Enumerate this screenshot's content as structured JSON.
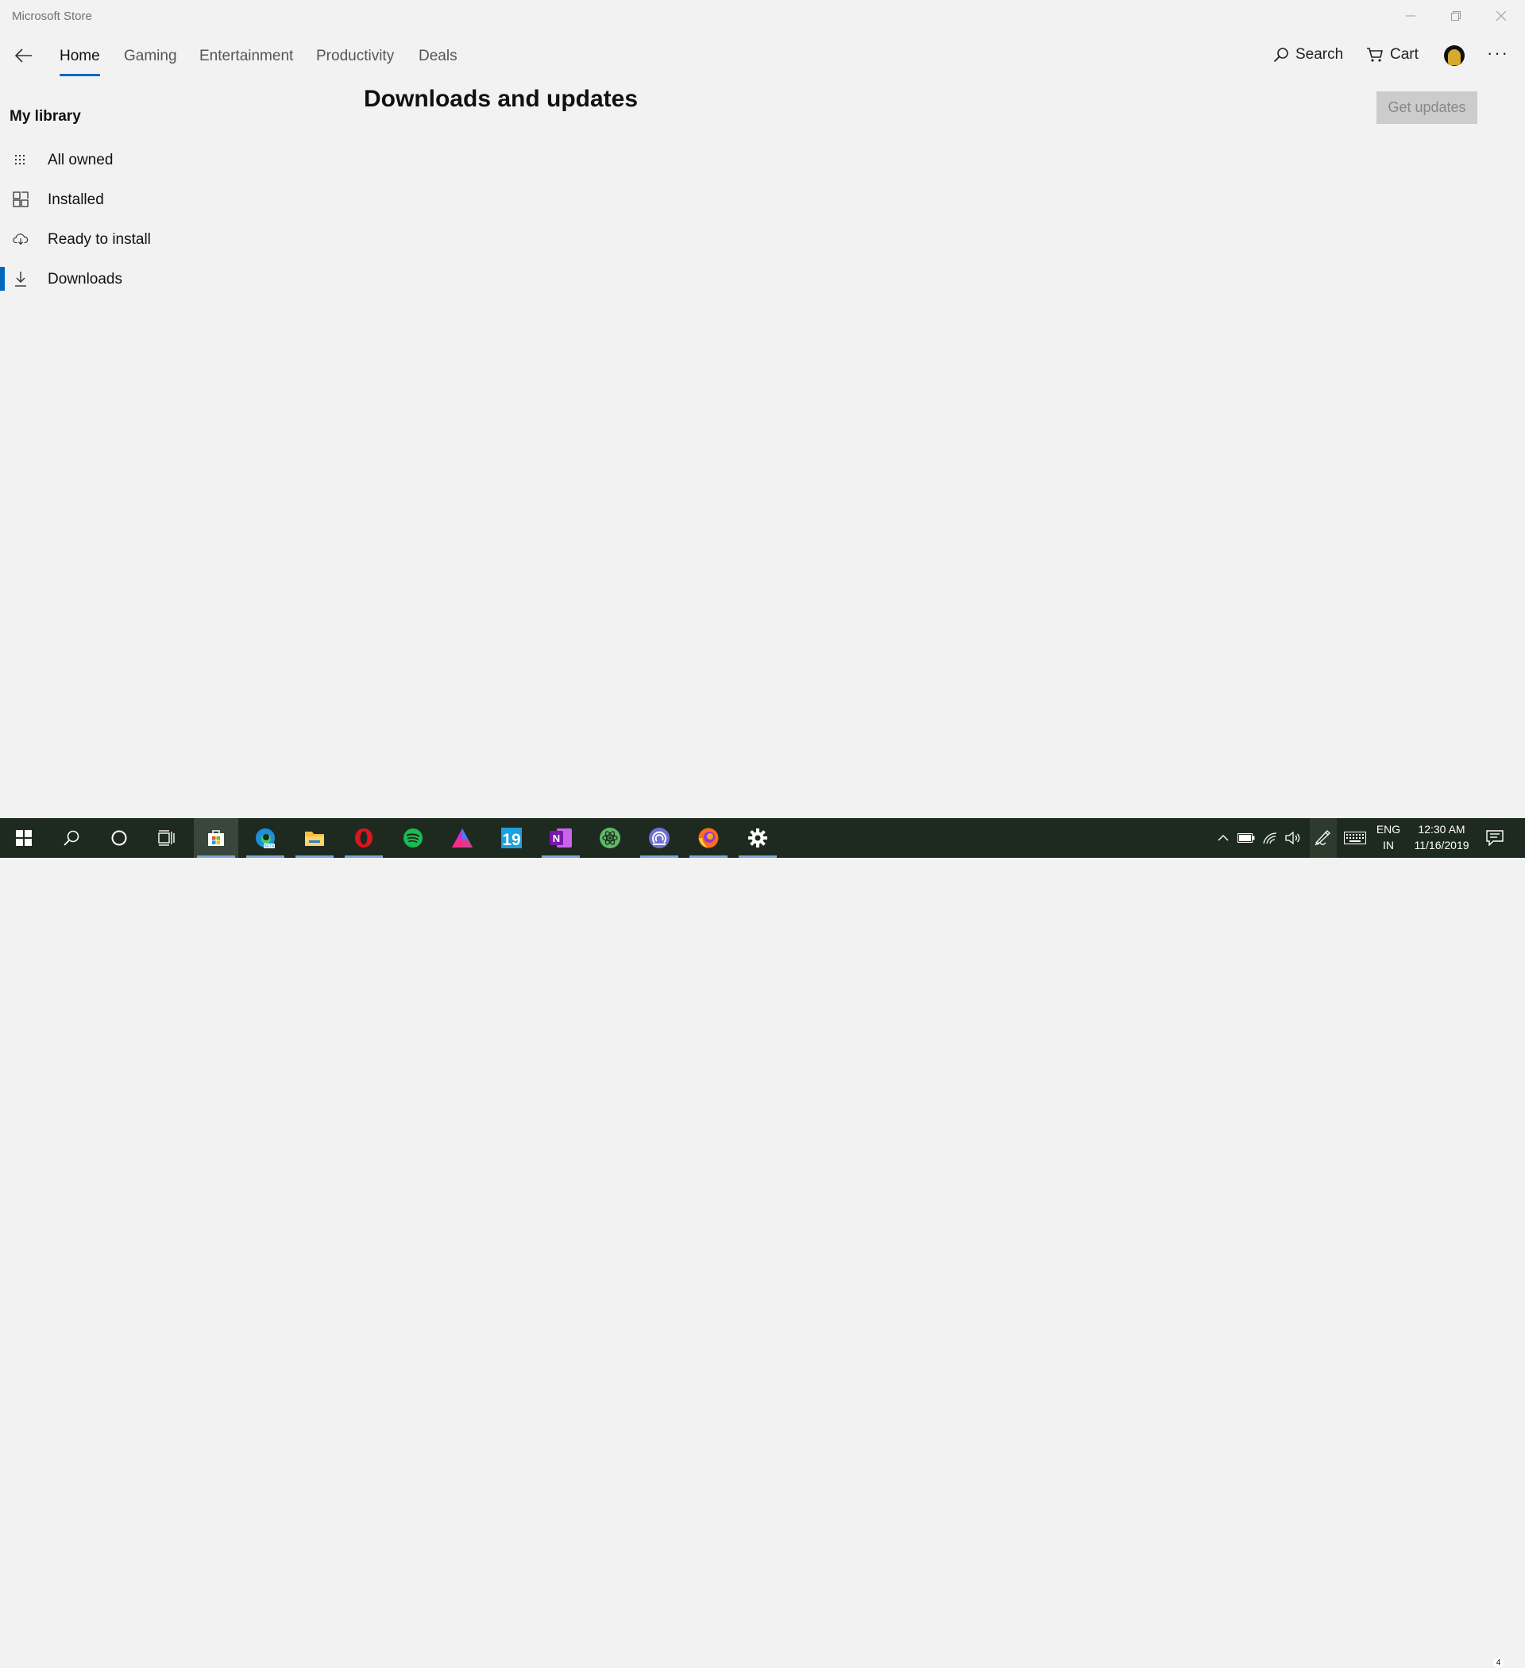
{
  "window": {
    "title": "Microsoft Store",
    "controls": [
      "minimize-icon",
      "restore-icon",
      "close-icon"
    ]
  },
  "nav": {
    "tabs": [
      {
        "label": "Home",
        "active": true
      },
      {
        "label": "Gaming",
        "active": false
      },
      {
        "label": "Entertainment",
        "active": false
      },
      {
        "label": "Productivity",
        "active": false
      },
      {
        "label": "Deals",
        "active": false
      }
    ],
    "search_label": "Search",
    "cart_label": "Cart",
    "more_label": "···"
  },
  "sidebar": {
    "heading": "My library",
    "items": [
      {
        "label": "All owned",
        "icon": "grid-dots-icon",
        "selected": false
      },
      {
        "label": "Installed",
        "icon": "app-grid-icon",
        "selected": false
      },
      {
        "label": "Ready to install",
        "icon": "cloud-download-icon",
        "selected": false
      },
      {
        "label": "Downloads",
        "icon": "download-icon",
        "selected": true
      }
    ]
  },
  "main": {
    "title": "Downloads and updates",
    "get_updates_label": "Get updates"
  },
  "taskbar": {
    "apps": [
      "windows-start-icon",
      "search-icon",
      "cortana-icon",
      "task-view-icon",
      "store-icon",
      "edge-beta-icon",
      "file-explorer-icon",
      "opera-icon",
      "spotify-icon",
      "affinity-icon",
      "nineteen-app-icon",
      "onenote-icon",
      "atom-icon",
      "bittorrent-icon",
      "firefox-icon",
      "settings-icon"
    ],
    "tray": {
      "language_top": "ENG",
      "language_bottom": "IN",
      "time": "12:30 AM",
      "date": "11/16/2019",
      "notification_count": "4"
    }
  },
  "colors": {
    "accent": "#0067c0",
    "background": "#f2f2f2",
    "taskbar": "#1e2a1f"
  }
}
